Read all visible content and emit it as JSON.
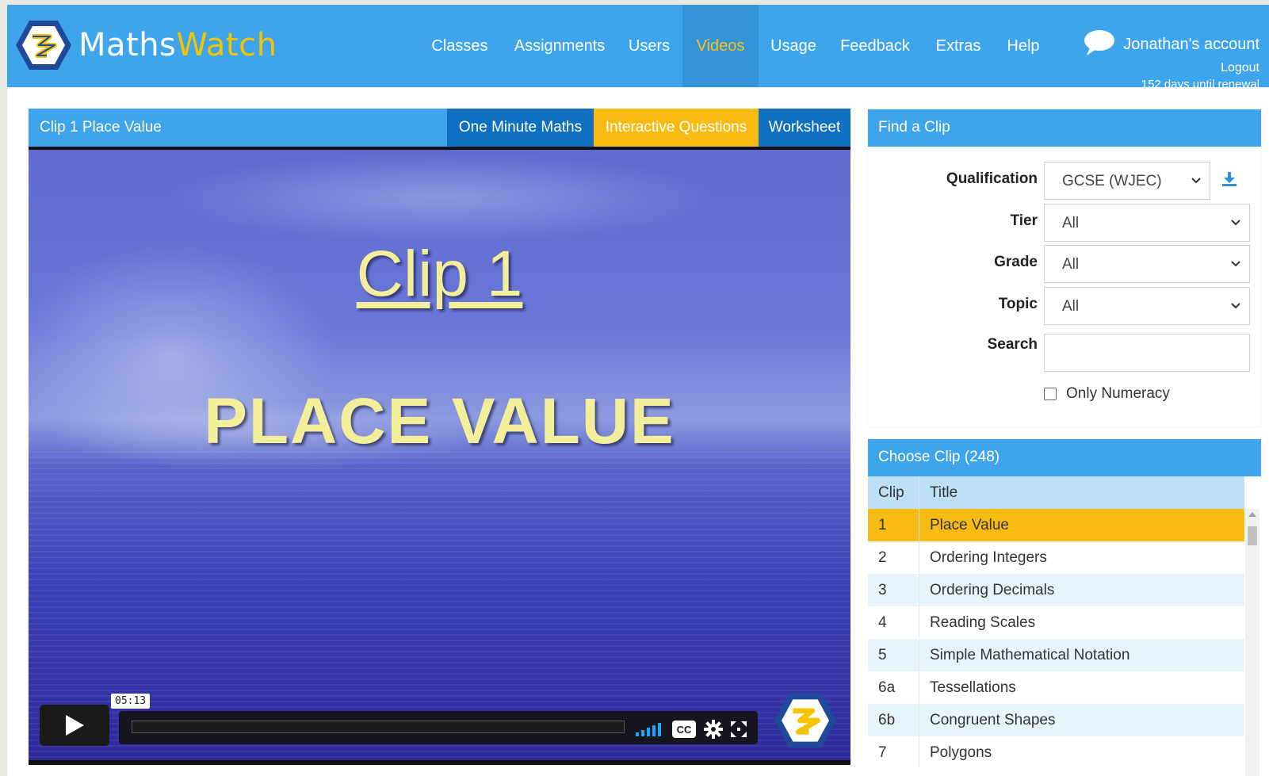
{
  "brand": {
    "part1": "Maths",
    "part2": "Watch"
  },
  "colors": {
    "nav_bg": "#3ea4ec",
    "accent_yellow": "#f7bb14",
    "tab_blue": "#0f6fc0",
    "active_nav": "#3594d6"
  },
  "nav": {
    "items": [
      "Classes",
      "Assignments",
      "Users",
      "Videos",
      "Usage",
      "Feedback",
      "Extras",
      "Help"
    ],
    "active": "Videos"
  },
  "account": {
    "name": "Jonathan's account",
    "logout": "Logout",
    "renewal": "152 days until renewal"
  },
  "video": {
    "title": "Clip 1 Place Value",
    "tabs": {
      "one_minute": "One Minute Maths",
      "interactive": "Interactive Questions",
      "worksheet": "Worksheet"
    },
    "heading": "Clip 1",
    "subtitle": "PLACE VALUE",
    "duration": "05:13",
    "icons": [
      "play-icon",
      "volume-bars-icon",
      "cc-icon",
      "gear-icon",
      "fullscreen-icon"
    ]
  },
  "find": {
    "title": "Find a Clip",
    "qualification_label": "Qualification",
    "qualification_value": "GCSE (WJEC)",
    "tier_label": "Tier",
    "tier_value": "All",
    "grade_label": "Grade",
    "grade_value": "All",
    "topic_label": "Topic",
    "topic_value": "All",
    "search_label": "Search",
    "search_value": "",
    "numeracy_label": "Only Numeracy"
  },
  "choose": {
    "title": "Choose Clip (248)",
    "col_clip": "Clip",
    "col_title": "Title",
    "selected": "1",
    "rows": [
      {
        "clip": "1",
        "title": "Place Value"
      },
      {
        "clip": "2",
        "title": "Ordering Integers"
      },
      {
        "clip": "3",
        "title": "Ordering Decimals"
      },
      {
        "clip": "4",
        "title": "Reading Scales"
      },
      {
        "clip": "5",
        "title": "Simple Mathematical Notation"
      },
      {
        "clip": "6a",
        "title": "Tessellations"
      },
      {
        "clip": "6b",
        "title": "Congruent Shapes"
      },
      {
        "clip": "7",
        "title": "Polygons"
      }
    ]
  }
}
